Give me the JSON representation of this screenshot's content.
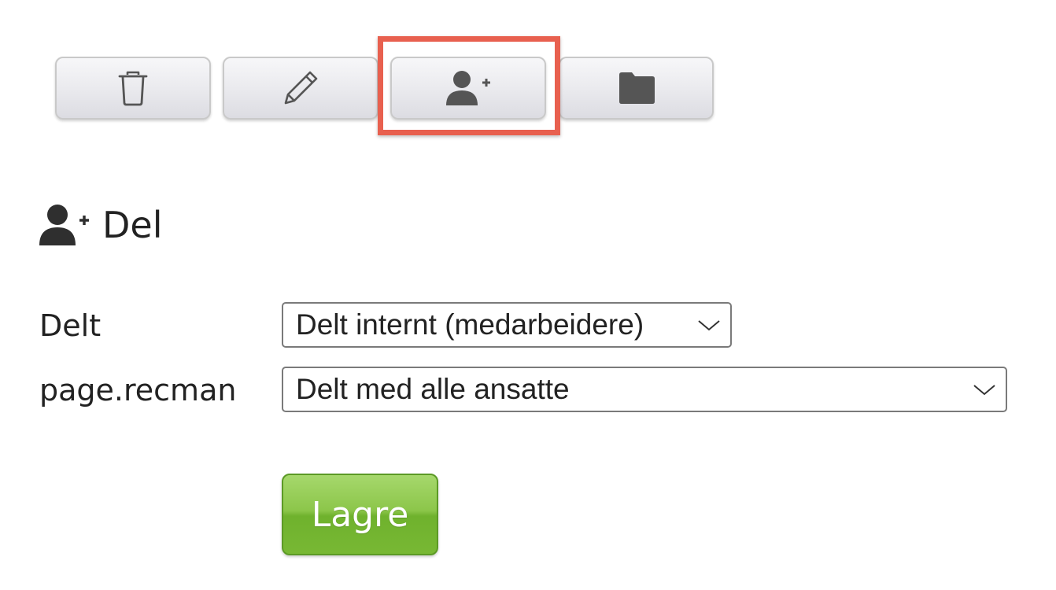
{
  "toolbar": {
    "buttons": [
      {
        "name": "delete",
        "icon": "trash-icon"
      },
      {
        "name": "edit",
        "icon": "pencil-icon"
      },
      {
        "name": "share",
        "icon": "user-plus-icon",
        "highlighted": true
      },
      {
        "name": "folder",
        "icon": "folder-icon"
      }
    ],
    "highlight_color": "#e8604f"
  },
  "section": {
    "icon": "user-plus-icon",
    "title": "Del"
  },
  "form": {
    "shared": {
      "label": "Delt",
      "selected": "Delt internt (medarbeidere)"
    },
    "recman": {
      "label": "page.recman",
      "selected": "Delt med alle ansatte"
    },
    "save_label": "Lagre"
  },
  "colors": {
    "save_button": "#7cbc38",
    "text": "#222222",
    "icon": "#555555"
  }
}
